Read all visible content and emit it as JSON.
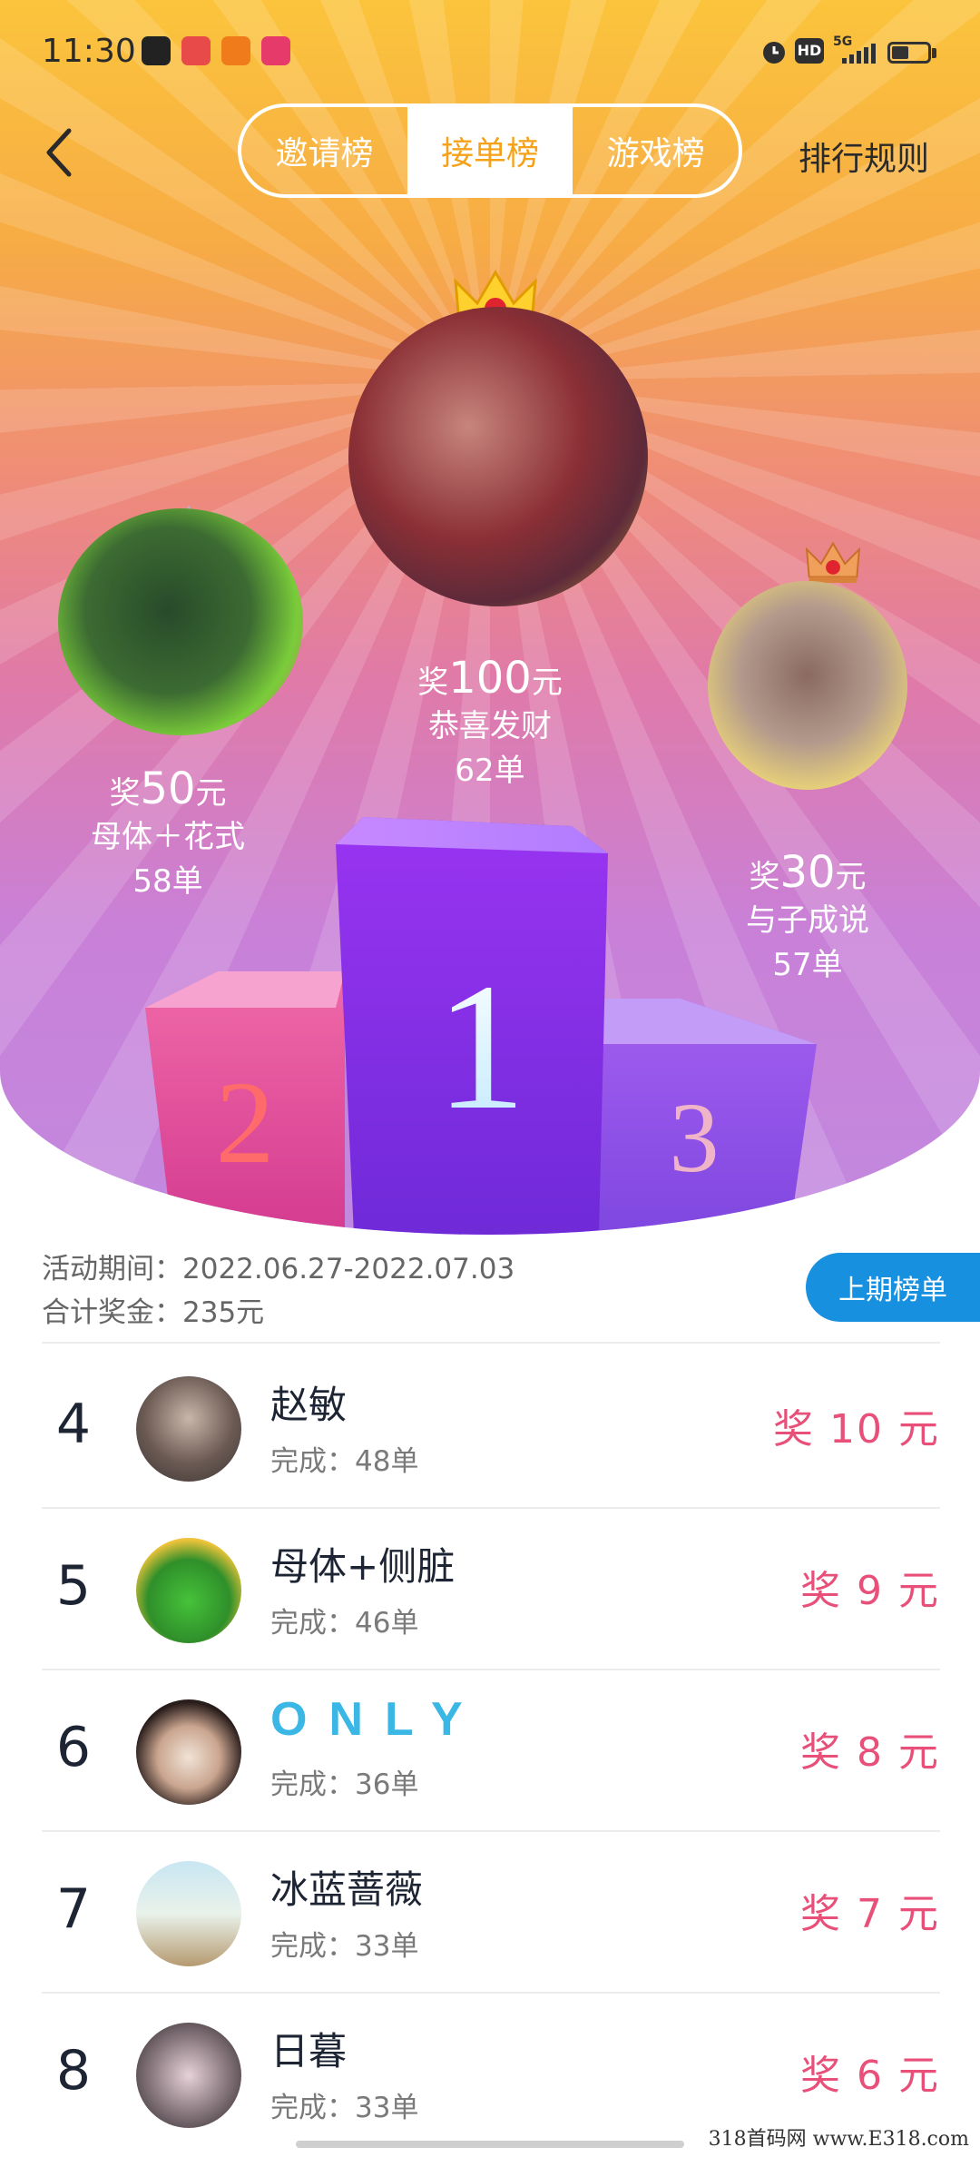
{
  "status_bar": {
    "time": "11:30",
    "badges": [
      "HD",
      "5G"
    ]
  },
  "header": {
    "tabs": [
      {
        "label": "邀请榜",
        "active": false
      },
      {
        "label": "接单榜",
        "active": true
      },
      {
        "label": "游戏榜",
        "active": false
      }
    ],
    "rules_label": "排行规则"
  },
  "podium": {
    "first": {
      "rank": "1",
      "prize_prefix": "奖",
      "prize_amount": "100",
      "prize_unit": "元",
      "name": "恭喜发财",
      "count": "62单"
    },
    "second": {
      "rank": "2",
      "prize_prefix": "奖",
      "prize_amount": "50",
      "prize_unit": "元",
      "name": "母体＋花式",
      "count": "58单"
    },
    "third": {
      "rank": "3",
      "prize_prefix": "奖",
      "prize_amount": "30",
      "prize_unit": "元",
      "name": "与子成说",
      "count": "57单"
    }
  },
  "info": {
    "period": "活动期间：2022.06.27-2022.07.03",
    "total": "合计奖金：235元",
    "prev_button": "上期榜单"
  },
  "rows": [
    {
      "rank": "4",
      "name": "赵敏",
      "done": "完成：48单",
      "prize": "奖 10 元"
    },
    {
      "rank": "5",
      "name": "母体+侧脏",
      "done": "完成：46单",
      "prize": "奖 9 元"
    },
    {
      "rank": "6",
      "name": "ONLY",
      "done": "完成：36单",
      "prize": "奖 8 元"
    },
    {
      "rank": "7",
      "name": "冰蓝蔷薇",
      "done": "完成：33单",
      "prize": "奖 7 元"
    },
    {
      "rank": "8",
      "name": "日暮",
      "done": "完成：33单",
      "prize": "奖 6 元"
    }
  ],
  "watermark": "318首码网  www.E318.com",
  "colors": {
    "accent": "#f5a218",
    "prize": "#e8507a",
    "button": "#1890e0"
  }
}
